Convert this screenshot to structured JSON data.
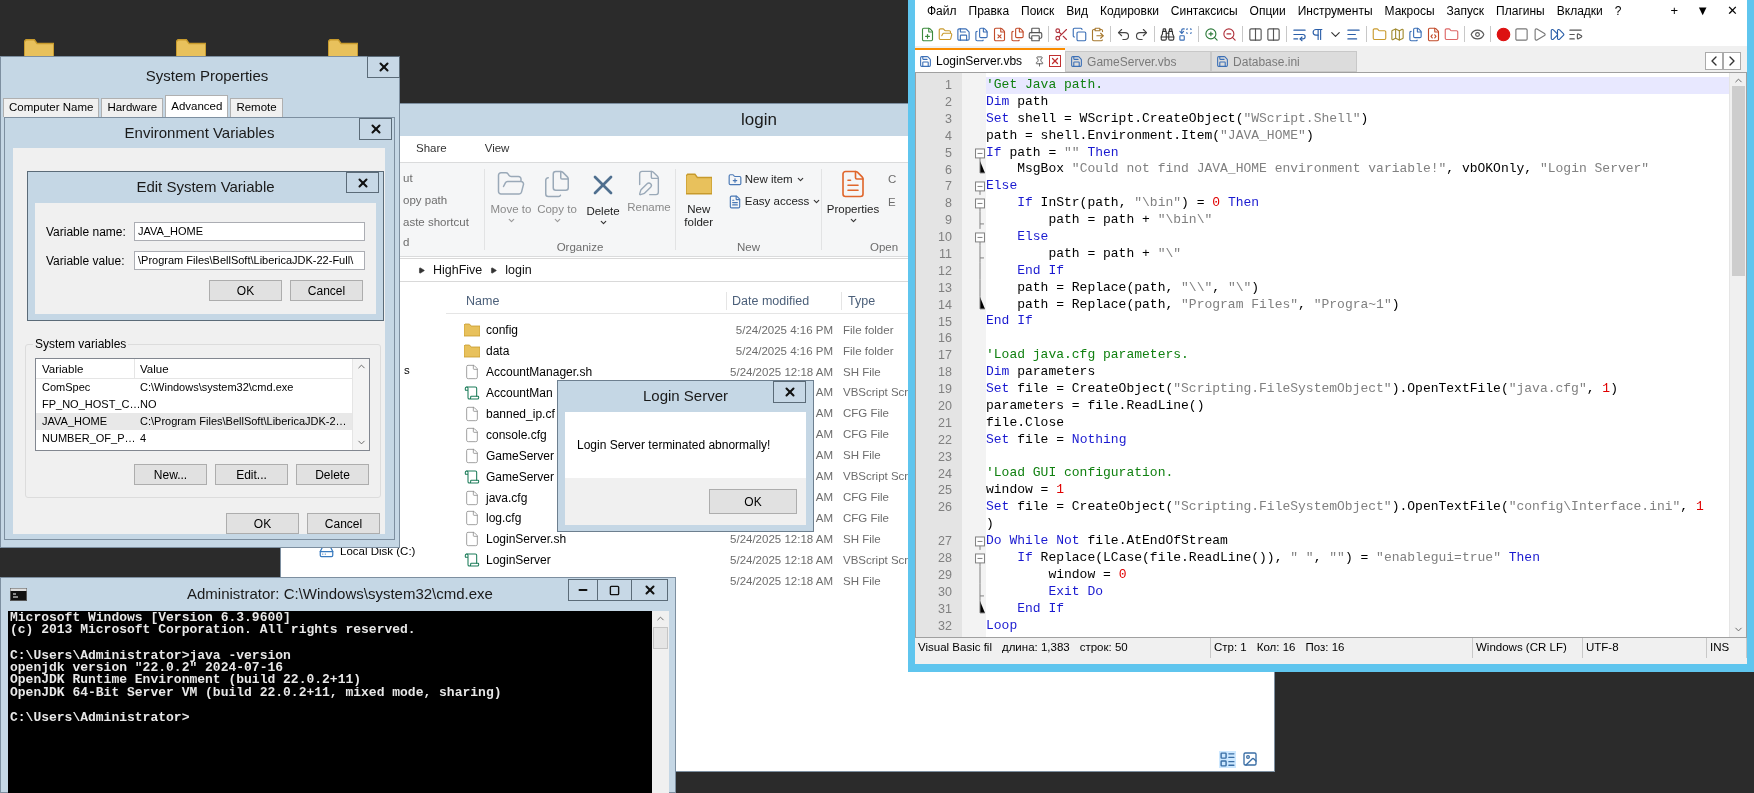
{
  "system_properties": {
    "title": "System Properties",
    "tabs": [
      {
        "label": "Computer Name",
        "selected": false
      },
      {
        "label": "Hardware",
        "selected": false
      },
      {
        "label": "Advanced",
        "selected": true
      },
      {
        "label": "Remote",
        "selected": false
      }
    ]
  },
  "environment_variables": {
    "title": "Environment Variables",
    "group_label": "System variables",
    "columns": [
      "Variable",
      "Value"
    ],
    "rows": [
      {
        "variable": "ComSpec",
        "value": "C:\\Windows\\system32\\cmd.exe",
        "selected": false
      },
      {
        "variable": "FP_NO_HOST_C…",
        "value": "NO",
        "selected": false
      },
      {
        "variable": "JAVA_HOME",
        "value": "C:\\Program Files\\BellSoft\\LibericaJDK-2…",
        "selected": true
      },
      {
        "variable": "NUMBER_OF_P…",
        "value": "4",
        "selected": false
      }
    ],
    "buttons": [
      "New...",
      "Edit...",
      "Delete"
    ],
    "footer_buttons": [
      "OK",
      "Cancel"
    ]
  },
  "edit_variable": {
    "title": "Edit System Variable",
    "fields": [
      {
        "label": "Variable name:",
        "value": "JAVA_HOME"
      },
      {
        "label": "Variable value:",
        "value": "\\Program Files\\BellSoft\\LibericaJDK-22-Full\\"
      }
    ],
    "buttons": [
      "OK",
      "Cancel"
    ]
  },
  "explorer": {
    "title": "login",
    "tabs": [
      "Share",
      "View"
    ],
    "clipboard": {
      "items": [
        "ut",
        "opy path",
        "aste shortcut"
      ],
      "label": "d"
    },
    "organize": {
      "label": "Organize",
      "buttons": [
        {
          "label": "Move to",
          "disabled": true,
          "dropdown": true
        },
        {
          "label": "Copy to",
          "disabled": true,
          "dropdown": true
        },
        {
          "label": "Delete",
          "disabled": false,
          "dropdown": true
        },
        {
          "label": "Rename",
          "disabled": true,
          "dropdown": false
        }
      ]
    },
    "new": {
      "label": "New",
      "folder": "New folder",
      "items": [
        "New item",
        "Easy access"
      ]
    },
    "open": {
      "label": "Open",
      "properties": "Properties",
      "items": [
        "C",
        "E"
      ]
    },
    "breadcrumb": [
      "HighFive",
      "login"
    ],
    "nav": [
      {
        "kind": "clipped",
        "label": "s"
      },
      {
        "kind": "drive",
        "label": "Local Disk (C:)"
      }
    ],
    "columns": [
      "Name",
      "Date modified",
      "Type"
    ],
    "rows": [
      {
        "kind": "folder",
        "name": "config",
        "date": "5/24/2025 4:16 PM",
        "type": "File folder"
      },
      {
        "kind": "folder",
        "name": "data",
        "date": "5/24/2025 4:16 PM",
        "type": "File folder"
      },
      {
        "kind": "file",
        "name": "AccountManager.sh",
        "date": "5/24/2025 12:18 AM",
        "type": "SH File"
      },
      {
        "kind": "script",
        "name": "AccountMan",
        "date": "AM",
        "type": "VBScript Scr"
      },
      {
        "kind": "file",
        "name": "banned_ip.cf",
        "date": "AM",
        "type": "CFG File"
      },
      {
        "kind": "file",
        "name": "console.cfg",
        "date": "AM",
        "type": "CFG File"
      },
      {
        "kind": "file",
        "name": "GameServer",
        "date": "AM",
        "type": "SH File"
      },
      {
        "kind": "script",
        "name": "GameServer",
        "date": "AM",
        "type": "VBScript Scr"
      },
      {
        "kind": "file",
        "name": "java.cfg",
        "date": "AM",
        "type": "CFG File"
      },
      {
        "kind": "file",
        "name": "log.cfg",
        "date": "AM",
        "type": "CFG File"
      },
      {
        "kind": "file",
        "name": "LoginServer.sh",
        "date": "5/24/2025 12:18 AM",
        "type": "SH File"
      },
      {
        "kind": "script",
        "name": "LoginServer",
        "date": "5/24/2025 12:18 AM",
        "type": "VBScript Scr"
      },
      {
        "kind": "hidden",
        "date": "5/24/2025 12:18 AM",
        "type": "SH File"
      }
    ]
  },
  "message_box": {
    "title": "Login Server",
    "message": "Login Server terminated abnormally!",
    "button": "OK"
  },
  "console": {
    "title": "Administrator: C:\\Windows\\system32\\cmd.exe",
    "blocks": [
      [
        "Microsoft Windows [Version 6.3.9600]",
        "(c) 2013 Microsoft Corporation. All rights reserved."
      ],
      [
        "C:\\Users\\Administrator>java -version",
        "openjdk version \"22.0.2\" 2024-07-16",
        "OpenJDK Runtime Environment (build 22.0.2+11)",
        "OpenJDK 64-Bit Server VM (build 22.0.2+11, mixed mode, sharing)"
      ],
      [
        "C:\\Users\\Administrator>"
      ]
    ]
  },
  "editor": {
    "menu": [
      "Файл",
      "Правка",
      "Поиск",
      "Вид",
      "Кодировки",
      "Синтаксисы",
      "Опции",
      "Инструменты",
      "Макросы",
      "Запуск",
      "Плагины",
      "Вкладки",
      "?"
    ],
    "menu_right": [
      "+",
      "▼",
      "✕"
    ],
    "tabs": [
      {
        "label": "LoginServer.vbs",
        "selected": true
      },
      {
        "label": "GameServer.vbs",
        "selected": false
      },
      {
        "label": "Database.ini",
        "selected": false
      }
    ],
    "lines": [
      {
        "number": "1",
        "current": true,
        "segments": [
          {
            "kind": "comment",
            "text": "'Get Java path."
          }
        ]
      },
      {
        "number": "2",
        "current": false,
        "segments": [
          {
            "kind": "keyword",
            "text": "Dim"
          },
          {
            "kind": "plain",
            "text": " path"
          }
        ]
      },
      {
        "number": "3",
        "current": false,
        "segments": [
          {
            "kind": "keyword",
            "text": "Set"
          },
          {
            "kind": "plain",
            "text": " shell = WScript.CreateObject("
          },
          {
            "kind": "string",
            "text": "\"WScript.Shell\""
          },
          {
            "kind": "plain",
            "text": ")"
          }
        ]
      },
      {
        "number": "4",
        "current": false,
        "segments": [
          {
            "kind": "plain",
            "text": "path = shell.Environment.Item("
          },
          {
            "kind": "string",
            "text": "\"JAVA_HOME\""
          },
          {
            "kind": "plain",
            "text": ")"
          }
        ]
      },
      {
        "number": "5",
        "current": false,
        "kind": "fold_start",
        "segments": [
          {
            "kind": "keyword",
            "text": "If"
          },
          {
            "kind": "plain",
            "text": " path = "
          },
          {
            "kind": "string",
            "text": "\"\""
          },
          {
            "kind": "keyword",
            "text": " Then"
          }
        ]
      },
      {
        "number": "6",
        "current": false,
        "kind": "fold_end",
        "segments": [
          {
            "kind": "plain",
            "text": "    MsgBox "
          },
          {
            "kind": "string",
            "text": "\"Could not find JAVA_HOME environment variable!\""
          },
          {
            "kind": "plain",
            "text": ", vbOKOnly, "
          },
          {
            "kind": "string",
            "text": "\"Login Server\""
          }
        ]
      },
      {
        "number": "7",
        "current": false,
        "kind": "fold_start",
        "segments": [
          {
            "kind": "keyword",
            "text": "Else"
          }
        ]
      },
      {
        "number": "8",
        "current": false,
        "kind": "fold_start",
        "segments": [
          {
            "kind": "keyword",
            "text": "    If"
          },
          {
            "kind": "plain",
            "text": " InStr(path, "
          },
          {
            "kind": "string",
            "text": "\"\\bin\""
          },
          {
            "kind": "plain",
            "text": ") = "
          },
          {
            "kind": "number",
            "text": "0"
          },
          {
            "kind": "keyword",
            "text": " Then"
          }
        ]
      },
      {
        "number": "9",
        "current": false,
        "kind": "fold_branch",
        "segments": [
          {
            "kind": "plain",
            "text": "        path = path + "
          },
          {
            "kind": "string",
            "text": "\"\\bin\\\""
          }
        ]
      },
      {
        "number": "10",
        "current": false,
        "kind": "fold_start",
        "segments": [
          {
            "kind": "keyword",
            "text": "    Else"
          }
        ]
      },
      {
        "number": "11",
        "current": false,
        "kind": "fold_branch",
        "segments": [
          {
            "kind": "plain",
            "text": "        path = path + "
          },
          {
            "kind": "string",
            "text": "\"\\\""
          }
        ]
      },
      {
        "number": "12",
        "current": false,
        "kind": "fold_line",
        "segments": [
          {
            "kind": "keyword",
            "text": "    End If"
          }
        ]
      },
      {
        "number": "13",
        "current": false,
        "kind": "fold_line",
        "segments": [
          {
            "kind": "plain",
            "text": "    path = Replace(path, "
          },
          {
            "kind": "string",
            "text": "\"\\\\\""
          },
          {
            "kind": "plain",
            "text": ", "
          },
          {
            "kind": "string",
            "text": "\"\\\""
          },
          {
            "kind": "plain",
            "text": ")"
          }
        ]
      },
      {
        "number": "14",
        "current": false,
        "kind": "fold_end",
        "segments": [
          {
            "kind": "plain",
            "text": "    path = Replace(path, "
          },
          {
            "kind": "string",
            "text": "\"Program Files\""
          },
          {
            "kind": "plain",
            "text": ", "
          },
          {
            "kind": "string",
            "text": "\"Progra~1\""
          },
          {
            "kind": "plain",
            "text": ")"
          }
        ]
      },
      {
        "number": "15",
        "current": false,
        "segments": [
          {
            "kind": "keyword",
            "text": "End If"
          }
        ]
      },
      {
        "number": "16",
        "current": false
      },
      {
        "number": "17",
        "current": false,
        "segments": [
          {
            "kind": "comment",
            "text": "'Load java.cfg parameters."
          }
        ]
      },
      {
        "number": "18",
        "current": false,
        "segments": [
          {
            "kind": "keyword",
            "text": "Dim"
          },
          {
            "kind": "plain",
            "text": " parameters"
          }
        ]
      },
      {
        "number": "19",
        "current": false,
        "segments": [
          {
            "kind": "keyword",
            "text": "Set"
          },
          {
            "kind": "plain",
            "text": " file = CreateObject("
          },
          {
            "kind": "string",
            "text": "\"Scripting.FileSystemObject\""
          },
          {
            "kind": "plain",
            "text": ").OpenTextFile("
          },
          {
            "kind": "string",
            "text": "\"java.cfg\""
          },
          {
            "kind": "plain",
            "text": ", "
          },
          {
            "kind": "number",
            "text": "1"
          },
          {
            "kind": "plain",
            "text": ")"
          }
        ]
      },
      {
        "number": "20",
        "current": false,
        "segments": [
          {
            "kind": "plain",
            "text": "parameters = file.ReadLine()"
          }
        ]
      },
      {
        "number": "21",
        "current": false,
        "segments": [
          {
            "kind": "plain",
            "text": "file.Close"
          }
        ]
      },
      {
        "number": "22",
        "current": false,
        "segments": [
          {
            "kind": "keyword",
            "text": "Set"
          },
          {
            "kind": "plain",
            "text": " file = "
          },
          {
            "kind": "keyword",
            "text": "Nothing"
          }
        ]
      },
      {
        "number": "23",
        "current": false
      },
      {
        "number": "24",
        "current": false,
        "segments": [
          {
            "kind": "comment",
            "text": "'Load GUI configuration."
          }
        ]
      },
      {
        "number": "25",
        "current": false,
        "segments": [
          {
            "kind": "plain",
            "text": "window = "
          },
          {
            "kind": "number",
            "text": "1"
          }
        ]
      },
      {
        "number": "26",
        "current": false,
        "segments": [
          {
            "kind": "keyword",
            "text": "Set"
          },
          {
            "kind": "plain",
            "text": " file = CreateObject("
          },
          {
            "kind": "string",
            "text": "\"Scripting.FileSystemObject\""
          },
          {
            "kind": "plain",
            "text": ").OpenTextFile("
          },
          {
            "kind": "string",
            "text": "\"config\\Interface.ini\""
          },
          {
            "kind": "plain",
            "text": ", "
          },
          {
            "kind": "number",
            "text": "1"
          }
        ]
      },
      {
        "current": false,
        "segments": [
          {
            "kind": "plain",
            "text": ")"
          }
        ]
      },
      {
        "number": "27",
        "current": false,
        "kind": "fold_start",
        "segments": [
          {
            "kind": "keyword",
            "text": "Do While Not"
          },
          {
            "kind": "plain",
            "text": " file.AtEndOfStream"
          }
        ]
      },
      {
        "number": "28",
        "current": false,
        "kind": "fold_start",
        "segments": [
          {
            "kind": "keyword",
            "text": "    If"
          },
          {
            "kind": "plain",
            "text": " Replace(LCase(file.ReadLine()), "
          },
          {
            "kind": "string",
            "text": "\" \""
          },
          {
            "kind": "plain",
            "text": ", "
          },
          {
            "kind": "string",
            "text": "\"\""
          },
          {
            "kind": "plain",
            "text": ") = "
          },
          {
            "kind": "string",
            "text": "\"enablegui=true\""
          },
          {
            "kind": "keyword",
            "text": " Then"
          }
        ]
      },
      {
        "number": "29",
        "current": false,
        "kind": "fold_line",
        "segments": [
          {
            "kind": "plain",
            "text": "        window = "
          },
          {
            "kind": "number",
            "text": "0"
          }
        ]
      },
      {
        "number": "30",
        "current": false,
        "kind": "fold_branch",
        "segments": [
          {
            "kind": "keyword",
            "text": "        Exit Do"
          }
        ]
      },
      {
        "number": "31",
        "current": false,
        "kind": "fold_end",
        "segments": [
          {
            "kind": "keyword",
            "text": "    End If"
          }
        ]
      },
      {
        "number": "32",
        "current": false,
        "segments": [
          {
            "kind": "keyword",
            "text": "Loop"
          }
        ]
      }
    ],
    "status_bar": [
      [
        "Visual Basic fil",
        "длина: 1,383",
        "строк: 50"
      ],
      [
        "Стр: 1",
        "Кол: 16",
        "Поз: 16"
      ],
      [
        "Windows (CR LF)"
      ],
      [
        "UTF-8"
      ],
      [
        "INS"
      ]
    ]
  }
}
